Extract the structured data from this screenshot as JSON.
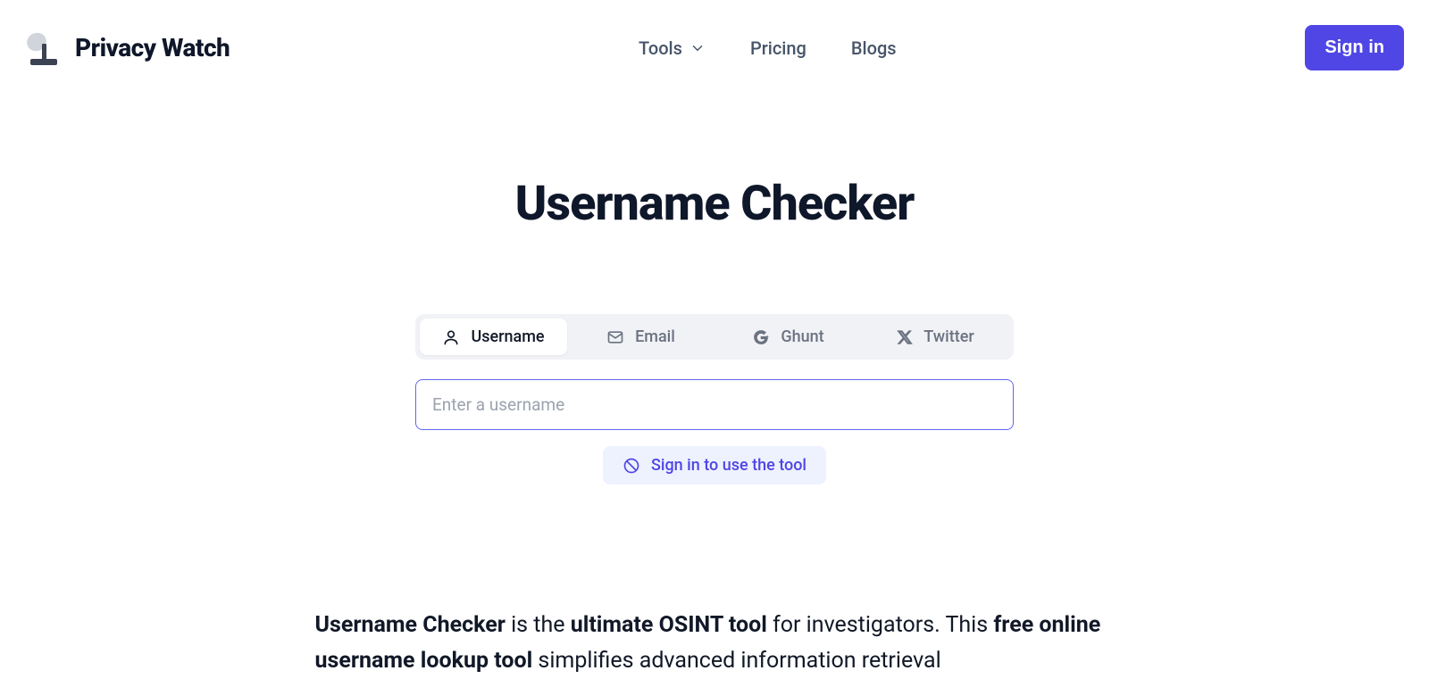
{
  "header": {
    "brand": "Privacy Watch",
    "nav": {
      "tools": "Tools",
      "pricing": "Pricing",
      "blogs": "Blogs"
    },
    "signin": "Sign in"
  },
  "main": {
    "title": "Username Checker",
    "tabs": {
      "username": "Username",
      "email": "Email",
      "ghunt": "Ghunt",
      "twitter": "Twitter"
    },
    "input_placeholder": "Enter a username",
    "signin_notice": "Sign in to use the tool",
    "desc": {
      "p1_b1": "Username Checker",
      "p1_t1": " is the ",
      "p1_b2": "ultimate OSINT tool",
      "p1_t2": " for investigators. This ",
      "p1_b3": "free online username lookup tool",
      "p1_t3": " simplifies advanced information retrieval"
    }
  }
}
